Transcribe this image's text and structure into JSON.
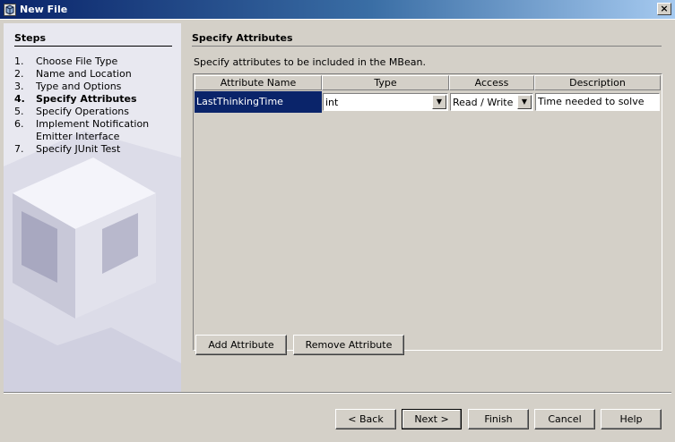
{
  "window": {
    "title": "New File",
    "close_glyph": "×",
    "icon": "netbeans-app-icon"
  },
  "steps": {
    "title": "Steps",
    "items": [
      {
        "num": "1.",
        "label": "Choose File Type"
      },
      {
        "num": "2.",
        "label": "Name and Location"
      },
      {
        "num": "3.",
        "label": "Type and Options"
      },
      {
        "num": "4.",
        "label": "Specify Attributes"
      },
      {
        "num": "5.",
        "label": "Specify Operations"
      },
      {
        "num": "6.",
        "label": "Implement Notification Emitter Interface"
      },
      {
        "num": "7.",
        "label": "Specify JUnit Test"
      }
    ],
    "current_step": "4."
  },
  "main": {
    "title": "Specify Attributes",
    "instruction": "Specify attributes to be included in the MBean.",
    "table": {
      "columns": [
        "Attribute Name",
        "Type",
        "Access",
        "Description"
      ],
      "rows": [
        {
          "name": "LastThinkingTime",
          "type": "int",
          "access": "Read / Write",
          "description": "Time needed to solve"
        }
      ]
    },
    "add_button": "Add Attribute",
    "remove_button": "Remove Attribute"
  },
  "footer": {
    "back": "< Back",
    "next": "Next >",
    "finish": "Finish",
    "cancel": "Cancel",
    "help": "Help"
  },
  "colors": {
    "selection": "#0a246a",
    "face": "#d4d0c8"
  }
}
